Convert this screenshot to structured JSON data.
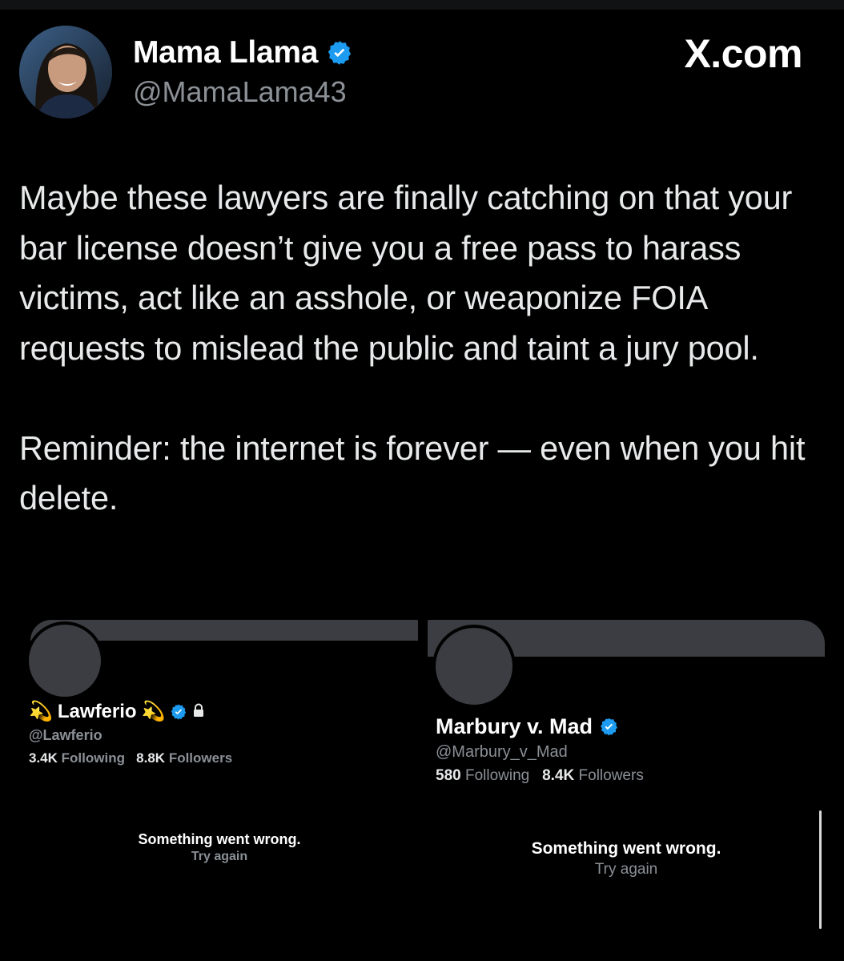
{
  "tweet": {
    "author_name": "Mama Llama",
    "author_handle": "@MamaLama43",
    "source": "X.com",
    "paragraph1": "Maybe these lawyers are finally catching on that your bar license doesn’t give you a free pass to harass victims, act like an asshole, or weaponize FOIA requests to mislead the public and taint a jury pool.",
    "paragraph2": "Reminder: the internet is forever — even when you hit delete."
  },
  "cards": [
    {
      "name": "Lawferio",
      "name_prefix_emoji": "💫",
      "name_suffix_emoji": "💫",
      "handle": "@Lawferio",
      "following_count": "3.4K",
      "following_label": "Following",
      "followers_count": "8.8K",
      "followers_label": "Followers",
      "error_title": "Something went wrong.",
      "error_action": "Try again",
      "verified": true,
      "protected": true
    },
    {
      "name": "Marbury v. Mad",
      "handle": "@Marbury_v_Mad",
      "following_count": "580",
      "following_label": "Following",
      "followers_count": "8.4K",
      "followers_label": "Followers",
      "error_title": "Something went wrong.",
      "error_action": "Try again",
      "verified": true
    }
  ],
  "colors": {
    "background": "#000000",
    "verified_badge": "#1d9bf0",
    "secondary_text": "#8b9096",
    "placeholder": "#3b3d42"
  },
  "icons": {
    "verified": "verified-badge-icon",
    "lock": "lock-icon",
    "sparkle": "dizzy-star-emoji"
  }
}
